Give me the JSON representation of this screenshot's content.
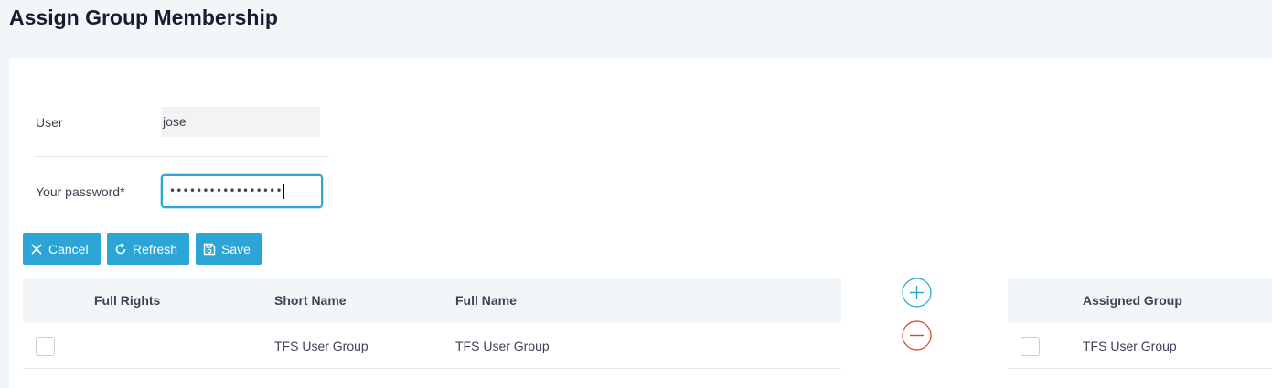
{
  "page": {
    "title": "Assign Group Membership"
  },
  "form": {
    "user_label": "User",
    "user_value": "jose",
    "password_label": "Your password*",
    "password_value": "•••••••••••••••••"
  },
  "toolbar": {
    "cancel_label": "Cancel",
    "refresh_label": "Refresh",
    "save_label": "Save"
  },
  "available_grid": {
    "columns": [
      "Full Rights",
      "Short Name",
      "Full Name"
    ],
    "rows": [
      {
        "full_rights": false,
        "short_name": "TFS User Group",
        "full_name": "TFS User Group"
      }
    ]
  },
  "assigned_grid": {
    "columns": [
      "Assigned Group"
    ],
    "rows": [
      {
        "selected": false,
        "assigned_group": "TFS User Group"
      }
    ]
  },
  "colors": {
    "accent": "#2aa5d6",
    "add_icon": "#2aa5d6",
    "remove_icon": "#e0432f"
  },
  "icons": {
    "cancel": "close-icon",
    "refresh": "refresh-icon",
    "save": "save-icon",
    "add": "plus-circle-icon",
    "remove": "minus-circle-icon"
  }
}
